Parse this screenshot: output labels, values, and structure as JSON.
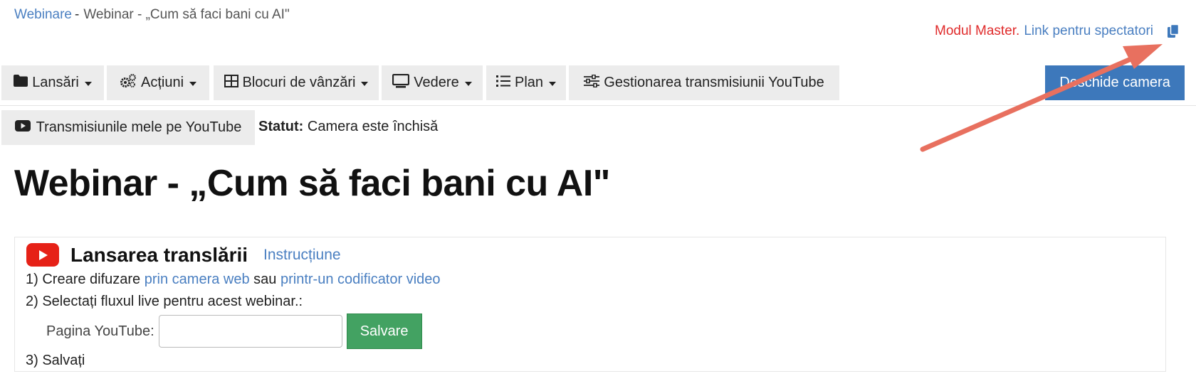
{
  "breadcrumb": {
    "root": "Webinare",
    "separator": "-",
    "current": "Webinar - „Cum să faci bani cu AI\""
  },
  "top_right": {
    "mode": "Modul Master.",
    "viewer_link": "Link pentru spectatori",
    "icon": "copy-icon"
  },
  "toolbar": {
    "items": [
      {
        "label": "Lansări",
        "icon": "folder-icon"
      },
      {
        "label": "Acțiuni",
        "icon": "gears-icon"
      },
      {
        "label": "Blocuri de vânzări",
        "icon": "grid-icon"
      },
      {
        "label": "Vedere",
        "icon": "monitor-icon"
      },
      {
        "label": "Plan",
        "icon": "list-icon"
      },
      {
        "label": "Gestionarea transmisiunii YouTube",
        "icon": "sliders-icon"
      }
    ],
    "open_camera": "Deschide camera",
    "my_streams": "Transmisiunile mele pe YouTube",
    "status_label": "Statut:",
    "status_value": "Camera este închisă"
  },
  "page_title": "Webinar - „Cum să faci bani cu AI\"",
  "panel": {
    "title": "Lansarea translării",
    "instructions": "Instrucțiune",
    "step1_prefix": "1) Creare difuzare",
    "step1_link1": "prin camera web",
    "step1_mid": "sau",
    "step1_link2": "printr-un codificator video",
    "step2": "2) Selectați fluxul live pentru acest webinar.:",
    "youtube_label": "Pagina YouTube:",
    "youtube_value": "",
    "save": "Salvare",
    "step3": "3) Salvați"
  },
  "colors": {
    "link": "#4a7fc1",
    "master": "#e02c2c",
    "primary": "#3d78bb",
    "success": "#43a262",
    "annotation_arrow": "#e8705f"
  }
}
